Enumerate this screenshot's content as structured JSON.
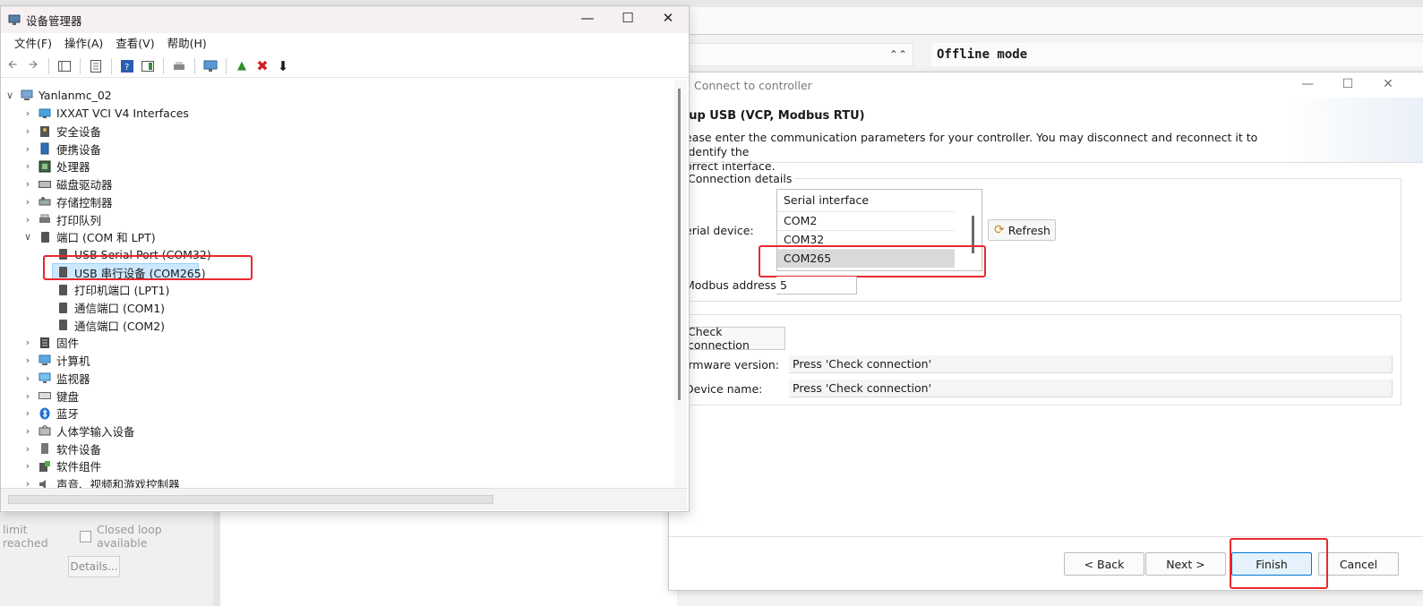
{
  "background": {
    "limit_reached": "limit reached",
    "closed_loop": "Closed loop available",
    "details": "Details...",
    "offline_mode": "Offline mode"
  },
  "connect_dialog": {
    "title": "Connect to controller",
    "heading": "tup USB (VCP, Modbus RTU)",
    "description_line1": "ease enter the communication parameters for your controller. You may disconnect and reconnect it to identify the",
    "description_line2": "orrect interface.",
    "connection_details": "Connection details",
    "serial_device_label": "erial device:",
    "serial_list_header": "Serial interface",
    "serial_options": [
      "COM2",
      "COM32",
      "COM265"
    ],
    "selected_serial": "COM265",
    "refresh": "Refresh",
    "modbus_label": "Modbus address",
    "modbus_value": "5",
    "check_connection": "Check connection",
    "firmware_label": "irmware version:",
    "firmware_value": "Press 'Check connection'",
    "device_name_label": "Device name:",
    "device_name_value": "Press 'Check connection'",
    "back": "< Back",
    "next": "Next >",
    "finish": "Finish",
    "cancel": "Cancel"
  },
  "device_manager": {
    "title": "设备管理器",
    "menus": [
      "文件(F)",
      "操作(A)",
      "查看(V)",
      "帮助(H)"
    ],
    "root": "Yanlanmc_02",
    "tree": [
      {
        "label": "IXXAT VCI V4 Interfaces",
        "expanded": false
      },
      {
        "label": "安全设备",
        "expanded": false
      },
      {
        "label": "便携设备",
        "expanded": false
      },
      {
        "label": "处理器",
        "expanded": false
      },
      {
        "label": "磁盘驱动器",
        "expanded": false
      },
      {
        "label": "存储控制器",
        "expanded": false
      },
      {
        "label": "打印队列",
        "expanded": false
      },
      {
        "label": "端口 (COM 和 LPT)",
        "expanded": true
      },
      {
        "label": "固件",
        "expanded": false
      },
      {
        "label": "计算机",
        "expanded": false
      },
      {
        "label": "监视器",
        "expanded": false
      },
      {
        "label": "键盘",
        "expanded": false
      },
      {
        "label": "蓝牙",
        "expanded": false
      },
      {
        "label": "人体学输入设备",
        "expanded": false
      },
      {
        "label": "软件设备",
        "expanded": false
      },
      {
        "label": "软件组件",
        "expanded": false
      },
      {
        "label": "声音、视频和游戏控制器",
        "expanded": false
      }
    ],
    "ports": [
      "USB Serial Port (COM32)",
      "USB 串行设备 (COM265)",
      "打印机端口 (LPT1)",
      "通信端口 (COM1)",
      "通信端口 (COM2)"
    ],
    "selected_port": "USB 串行设备 (COM265)"
  },
  "colors": {
    "highlight_red": "#e8292d",
    "selection_blue": "#cce8ff",
    "finish_border": "#0078d4"
  }
}
